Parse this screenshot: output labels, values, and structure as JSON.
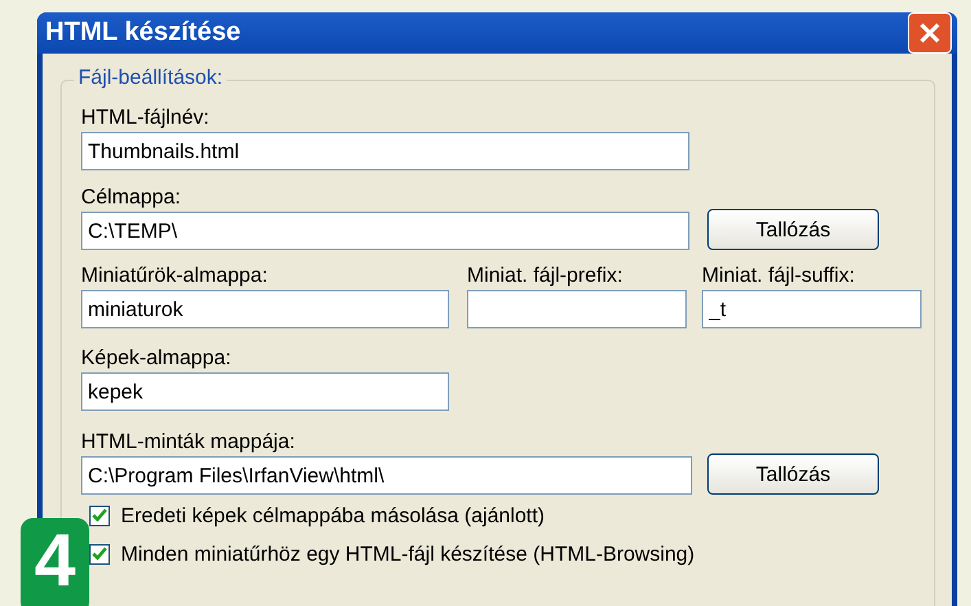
{
  "window": {
    "title": "HTML készítése"
  },
  "group": {
    "legend": "Fájl-beállítások:"
  },
  "html_filename": {
    "label": "HTML-fájlnév:",
    "value": "Thumbnails.html"
  },
  "target_folder": {
    "label": "Célmappa:",
    "value": "C:\\TEMP\\",
    "button": "Tallózás"
  },
  "thumb_subfolder": {
    "label": "Miniatűrök-almappa:",
    "value": "miniaturok"
  },
  "thumb_prefix": {
    "label": "Miniat. fájl-prefix:"
  },
  "thumb_suffix": {
    "label": "Miniat. fájl-suffix:",
    "value": "_t"
  },
  "images_subfolder": {
    "label": "Képek-almappa:",
    "value": "kepek"
  },
  "templates_folder": {
    "label": "HTML-minták mappája:",
    "value": "C:\\Program Files\\IrfanView\\html\\",
    "button": "Tallózás"
  },
  "options": [
    {
      "label": "Eredeti képek célmappába másolása (ajánlott)",
      "checked": true
    },
    {
      "label": "Minden miniatűrhöz egy HTML-fájl készítése (HTML-Browsing)",
      "checked": true
    }
  ],
  "step_badge": "4"
}
